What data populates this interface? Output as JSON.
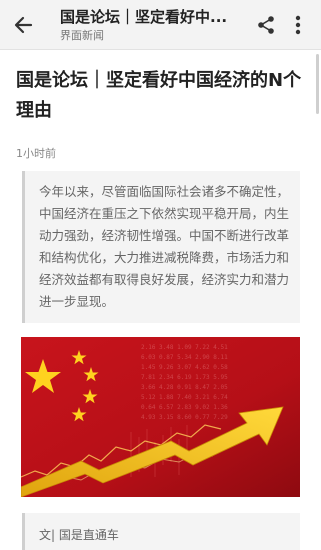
{
  "header": {
    "title": "国是论坛｜坚定看好中...",
    "source": "界面新闻",
    "back_icon": "arrow-left-icon",
    "share_icon": "share-icon",
    "more_icon": "more-vertical-icon"
  },
  "article": {
    "title": "国是论坛｜坚定看好中国经济的N个理由",
    "time": "1小时前",
    "summary": "今年以来，尽管面临国际社会诸多不确定性，中国经济在重压之下依然实现平稳开局，内生动力强劲，经济韧性增强。中国不断进行改革和结构优化，大力推进减税降费，市场活力和经济效益都有取得良好发展，经济实力和潜力进一步显现。",
    "byline": "文| 国是直通车"
  },
  "colors": {
    "header_bg": "#f3f3f3",
    "image_red": "#c4121a",
    "star_yellow": "#ffd21f",
    "arrow_yellow": "#f5c518"
  }
}
